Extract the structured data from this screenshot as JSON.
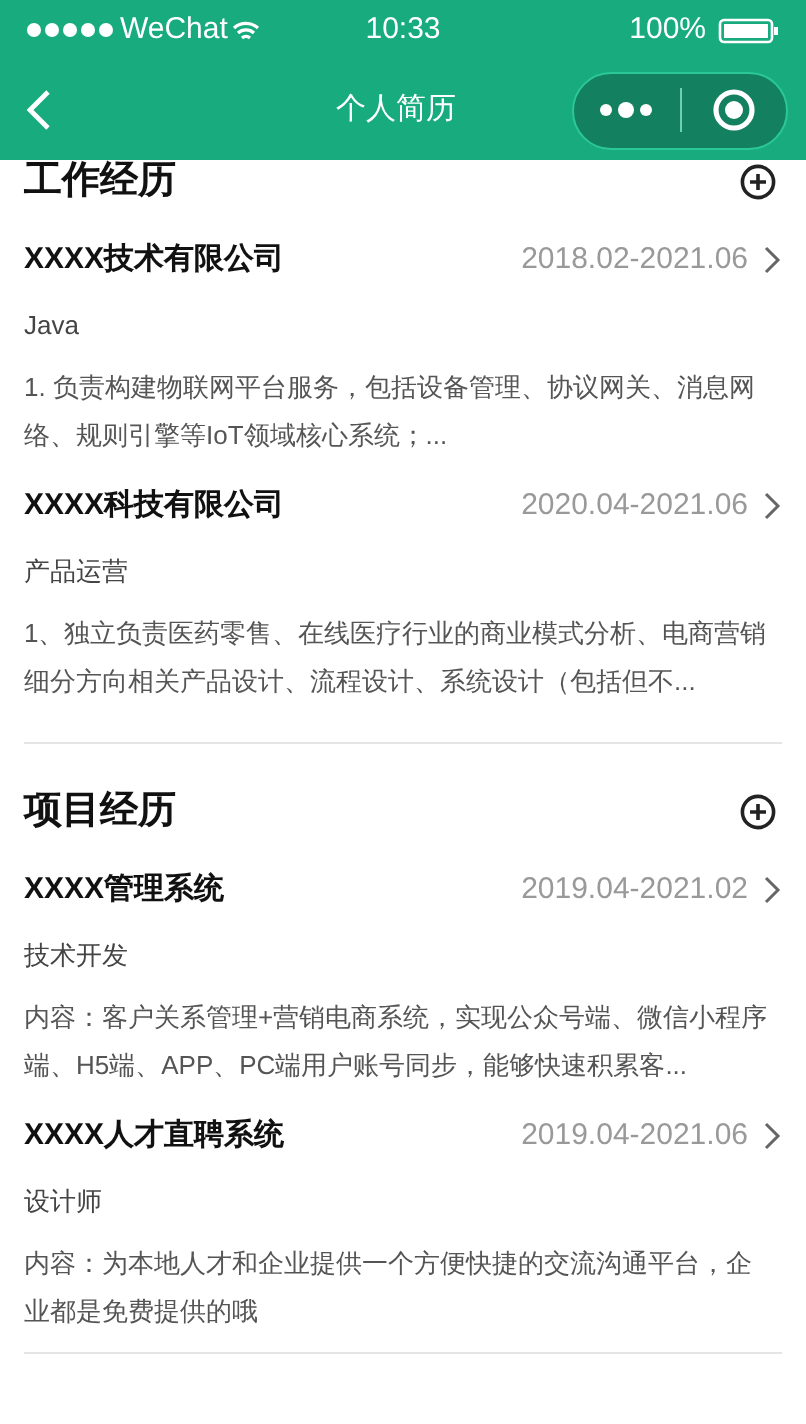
{
  "status_bar": {
    "carrier": "WeChat",
    "time": "10:33",
    "battery": "100%"
  },
  "nav": {
    "title": "个人简历"
  },
  "sections": [
    {
      "title": "工作经历",
      "items": [
        {
          "name": "XXXX技术有限公司",
          "period": "2018.02-2021.06",
          "role": "Java",
          "description": "1. 负责构建物联网平台服务，包括设备管理、协议网关、消息网络、规则引擎等IoT领域核心系统；..."
        },
        {
          "name": "XXXX科技有限公司",
          "period": "2020.04-2021.06",
          "role": "产品运营",
          "description": "1、独立负责医药零售、在线医疗行业的商业模式分析、电商营销细分方向相关产品设计、流程设计、系统设计（包括但不..."
        }
      ]
    },
    {
      "title": "项目经历",
      "items": [
        {
          "name": "XXXX管理系统",
          "period": "2019.04-2021.02",
          "role": "技术开发",
          "description": "内容：客户关系管理+营销电商系统，实现公众号端、微信小程序端、H5端、APP、PC端用户账号同步，能够快速积累客..."
        },
        {
          "name": "XXXX人才直聘系统",
          "period": "2019.04-2021.06",
          "role": "设计师",
          "description": "内容：为本地人才和企业提供一个方便快捷的交流沟通平台，企业都是免费提供的哦"
        }
      ]
    }
  ]
}
